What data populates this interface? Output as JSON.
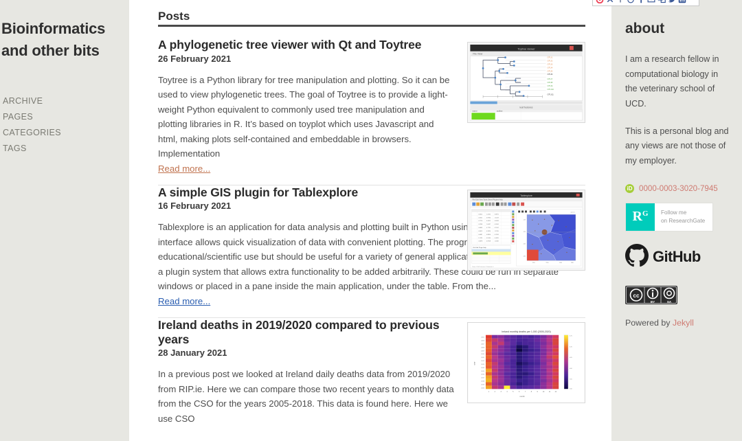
{
  "theme": {
    "sidebar_bg": "#e7e7e2",
    "content_bg": "#ffffff",
    "text": "#4d4d4d",
    "heading": "#2f2f2f",
    "link_visited": "#c0734f",
    "link_unvisited": "#2a5db0",
    "accent_red": "#cf7b72",
    "orcid_green": "#a6ce39",
    "researchgate_teal": "#00ccbb"
  },
  "left_sidebar": {
    "site_title_line1": "Bioinformatics",
    "site_title_line2": "and other bits",
    "nav": [
      {
        "label": "ARCHIVE",
        "name": "archive"
      },
      {
        "label": "PAGES",
        "name": "pages"
      },
      {
        "label": "CATEGORIES",
        "name": "categories"
      },
      {
        "label": "TAGS",
        "name": "tags"
      }
    ]
  },
  "main": {
    "section_heading": "Posts",
    "posts": [
      {
        "title": "A phylogenetic tree viewer with Qt and Toytree",
        "date": "26 February 2021",
        "excerpt": "Toytree is a Python library for tree manipulation and plotting. So it can be used to view phylogenetic trees. The goal of Toytree is to provide a light-weight Python equivalent to commonly used tree manipulation and plotting libraries in R. It’s based on toyplot which uses Javascript and html, making plots self-contained and embeddable in browsers. Implementation",
        "read_more": "Read more...",
        "read_more_state": "visited",
        "thumbnail_name": "phylogenetic-tree-viewer-screenshot"
      },
      {
        "title": "A simple GIS plugin for Tablexplore",
        "date": "16 February 2021",
        "excerpt": "Tablexplore is an application for data analysis and plotting built in Python using the PySide2/Qt toolkit. The interface allows quick visualization of data with convenient plotting. The program is intended mainly for educational/scientific use but should be useful for a variety of general applications. The program also has a plugin system that allows extra functionality to be added arbitrarily. These could be run in separate windows or placed in a pane inside the main application, under the table. From the...",
        "read_more": "Read more...",
        "read_more_state": "unvisited",
        "thumbnail_name": "gis-plugin-screenshot"
      },
      {
        "title": "Ireland deaths in 2019/2020 compared to previous years",
        "date": "28 January 2021",
        "excerpt": "In a previous post we looked at Ireland daily deaths data from 2019/2020 from RIP.ie. Here we can compare those two recent years to monthly data from the CSO for the years 2005-2018. This data is found here. Here we use CSO",
        "read_more": "",
        "read_more_state": "none",
        "thumbnail_name": "ireland-deaths-heatmap"
      }
    ]
  },
  "right_sidebar": {
    "heading": "about",
    "paragraphs": [
      "I am a research fellow in computational biology in the veterinary school of UCD.",
      "This is a personal blog and any views are not those of my employer."
    ],
    "orcid": {
      "icon_label": "iD",
      "id": "0000-0003-3020-7945"
    },
    "researchgate": {
      "mark": "R",
      "mark_sup": "G",
      "line1": "Follow me",
      "line2": "on ResearchGate"
    },
    "github": {
      "label": "GitHub"
    },
    "creative_commons": {
      "cc": "cc",
      "by": "BY",
      "sa": "SA"
    },
    "footer": {
      "prefix": "Powered by ",
      "link": "Jekyll"
    }
  },
  "share_strip": {
    "icons": [
      "pocket-icon",
      "close-icon",
      "plus-icon",
      "reddit-icon",
      "facebook-icon",
      "email-icon",
      "share-icon",
      "twitter-icon",
      "linkedin-icon"
    ]
  },
  "thumbnails": {
    "tree_viewer": {
      "window_title": "Toytree viewer",
      "menu": "File  View"
    },
    "gis_plugin": {
      "window_title": "Tablexplore"
    },
    "heatmap": {
      "title": "Ireland monthly deaths per 1,000 (2005-2020)",
      "xlabel": "month",
      "ylabel": "year"
    }
  }
}
